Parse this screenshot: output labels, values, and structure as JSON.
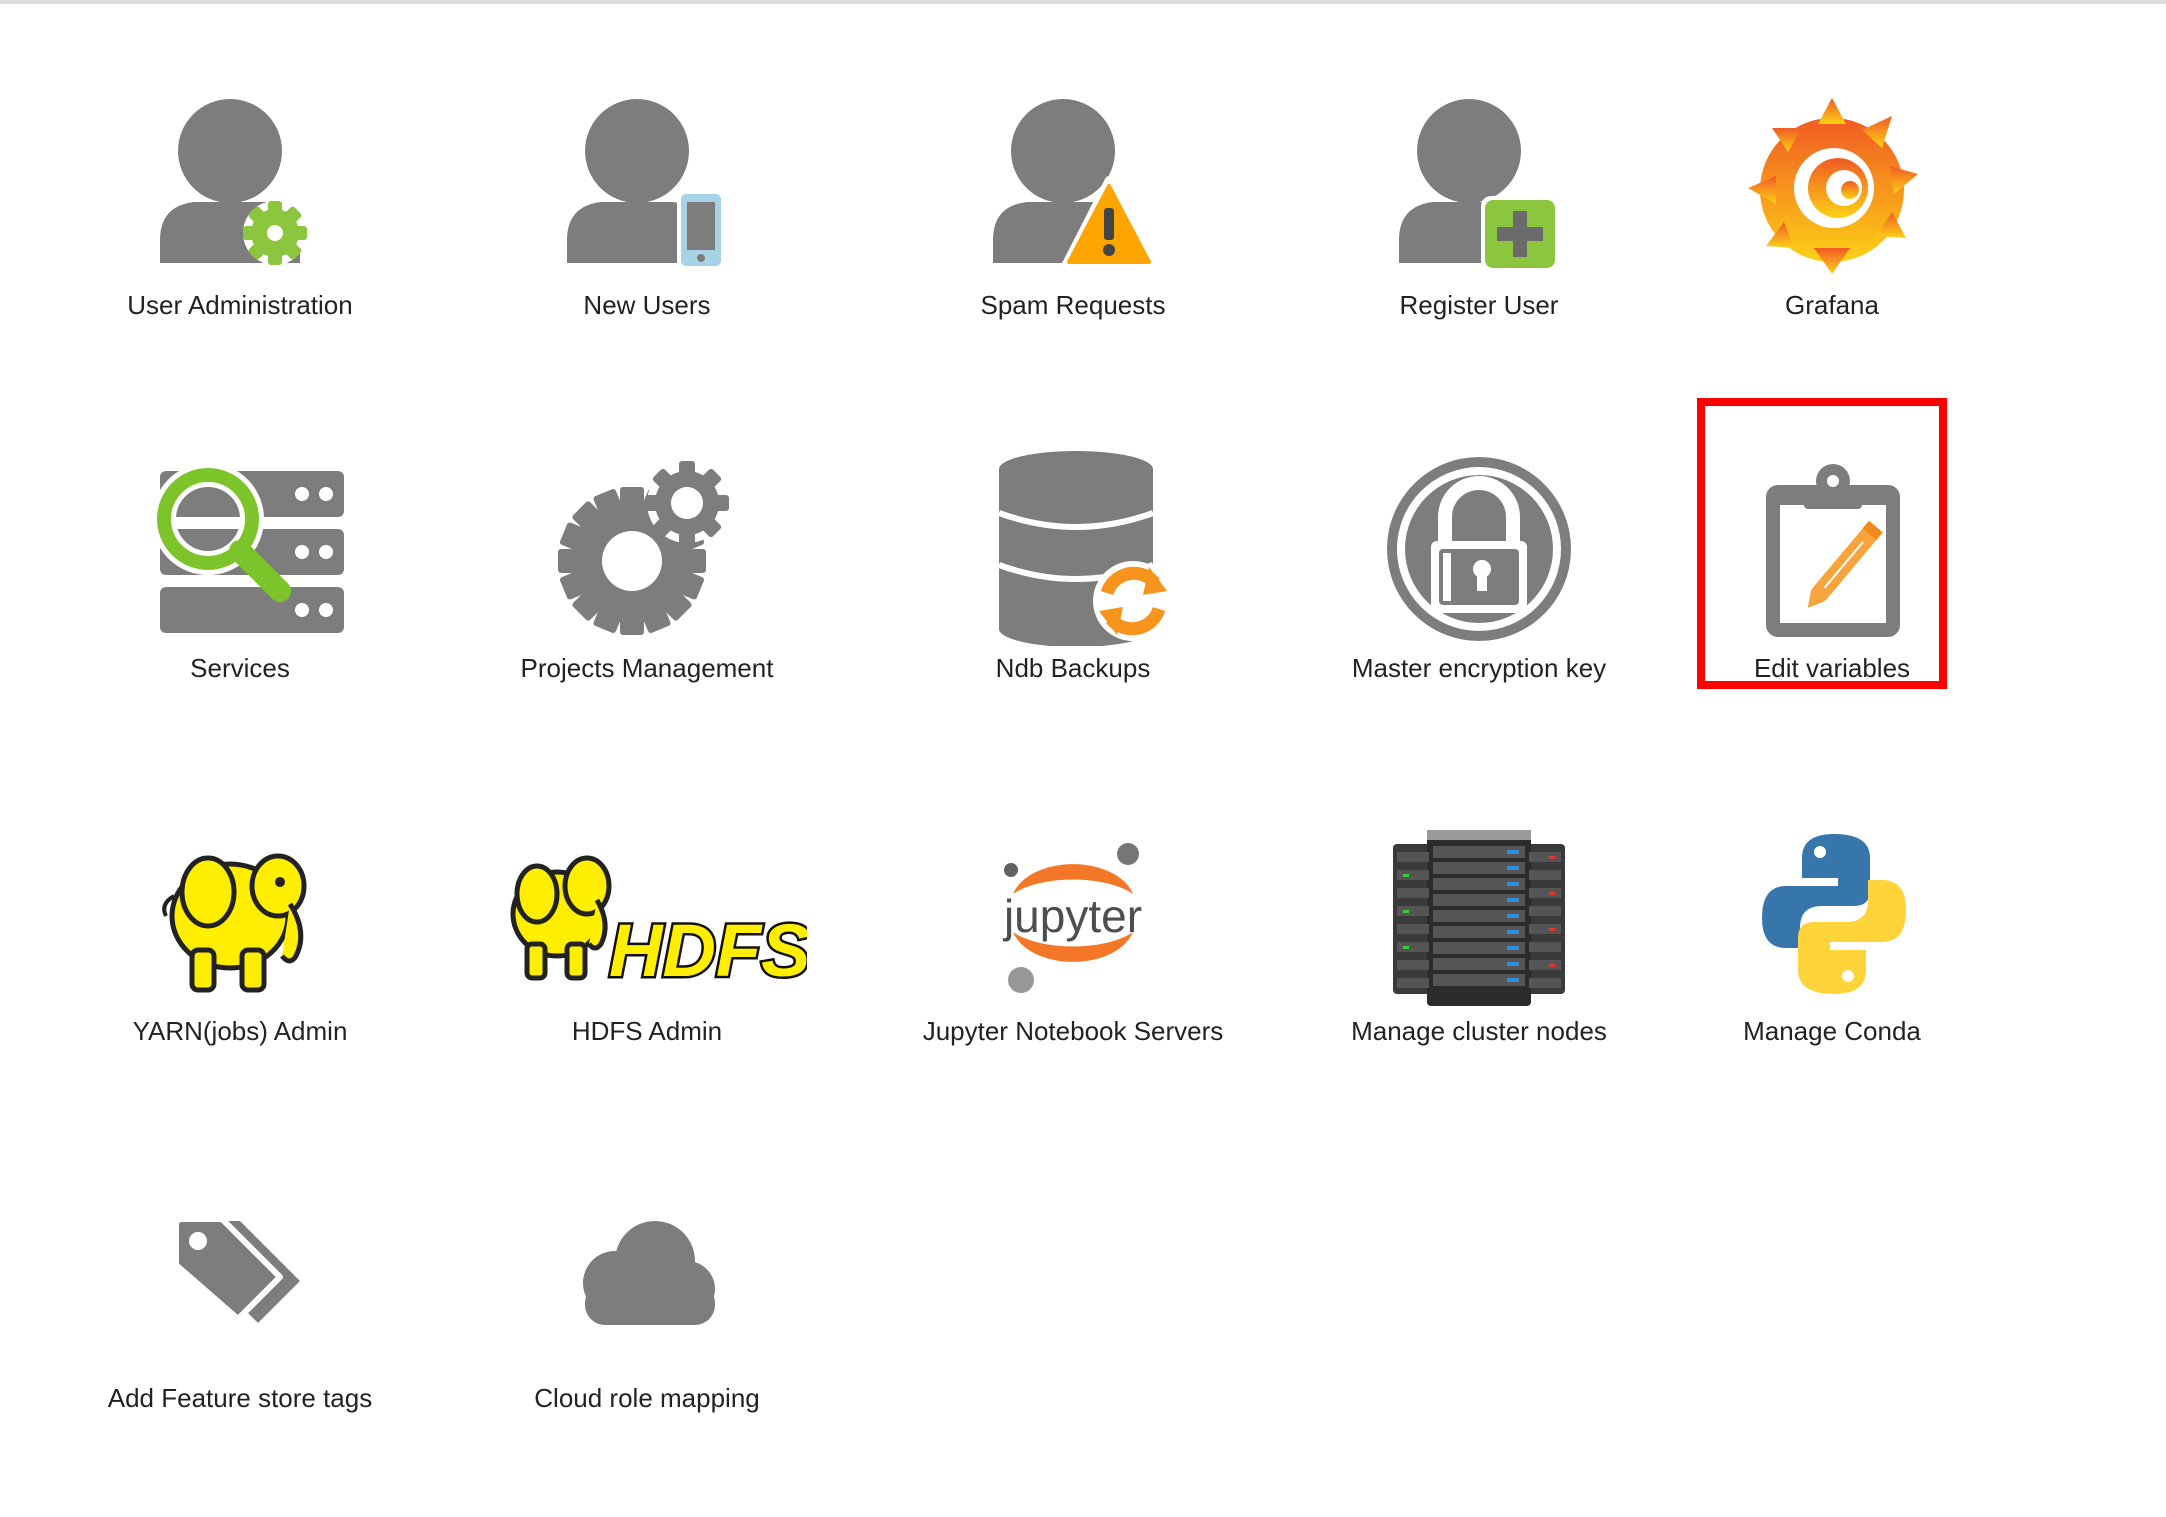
{
  "colors": {
    "icon_gray": "#7d7d7d",
    "green": "#8cc63f",
    "orange": "#f7941d",
    "warning": "#ffa500",
    "phone_blue": "#a7d3e6",
    "highlight_red": "#ff0000",
    "elephant_yellow": "#ffee00"
  },
  "tiles": [
    {
      "label": "User Administration",
      "icon": "user-gear-icon"
    },
    {
      "label": "New Users",
      "icon": "user-phone-icon"
    },
    {
      "label": "Spam Requests",
      "icon": "user-warning-icon"
    },
    {
      "label": "Register User",
      "icon": "user-plus-icon"
    },
    {
      "label": "Grafana",
      "icon": "grafana-logo-icon"
    },
    {
      "label": "Services",
      "icon": "server-search-icon"
    },
    {
      "label": "Projects Management",
      "icon": "gears-icon"
    },
    {
      "label": "Ndb Backups",
      "icon": "database-sync-icon"
    },
    {
      "label": "Master encryption key",
      "icon": "lock-icon"
    },
    {
      "label": "Edit variables",
      "icon": "clipboard-edit-icon"
    },
    {
      "label": "YARN(jobs) Admin",
      "icon": "hadoop-elephant-icon"
    },
    {
      "label": "HDFS Admin",
      "icon": "hdfs-logo-icon"
    },
    {
      "label": "Jupyter Notebook Servers",
      "icon": "jupyter-logo-icon"
    },
    {
      "label": "Manage cluster nodes",
      "icon": "server-rack-icon"
    },
    {
      "label": "Manage Conda",
      "icon": "python-logo-icon"
    },
    {
      "label": "Add Feature store tags",
      "icon": "tags-icon"
    },
    {
      "label": "Cloud role mapping",
      "icon": "cloud-icon"
    }
  ],
  "logos": {
    "hdfs_text": "HDFS",
    "jupyter_text": "jupyter"
  }
}
